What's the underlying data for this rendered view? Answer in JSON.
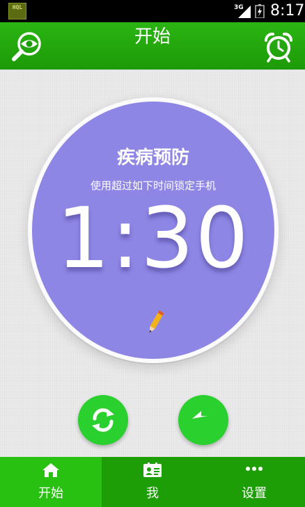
{
  "status": {
    "app_badge": "HQL",
    "network": "3G",
    "time": "8:17"
  },
  "header": {
    "title": "开始",
    "left_icon": "search-eye-icon",
    "right_icon": "alarm-clock-icon"
  },
  "dial": {
    "title": "疾病预防",
    "subtitle": "使用超过如下时间锁定手机",
    "time": "1:30",
    "edit_icon": "pencil-icon"
  },
  "actions": {
    "left_icon": "refresh-icon",
    "right_icon": "back-arrow-icon"
  },
  "nav": {
    "items": [
      {
        "label": "开始",
        "icon": "home-icon",
        "active": true
      },
      {
        "label": "我",
        "icon": "profile-card-icon",
        "active": false
      },
      {
        "label": "设置",
        "icon": "more-dots-icon",
        "active": false
      }
    ]
  },
  "colors": {
    "primary_green": "#1d9d06",
    "active_tab_green": "#29c111",
    "dial_purple": "#8d86e4",
    "action_button_green": "#2ad02d"
  }
}
